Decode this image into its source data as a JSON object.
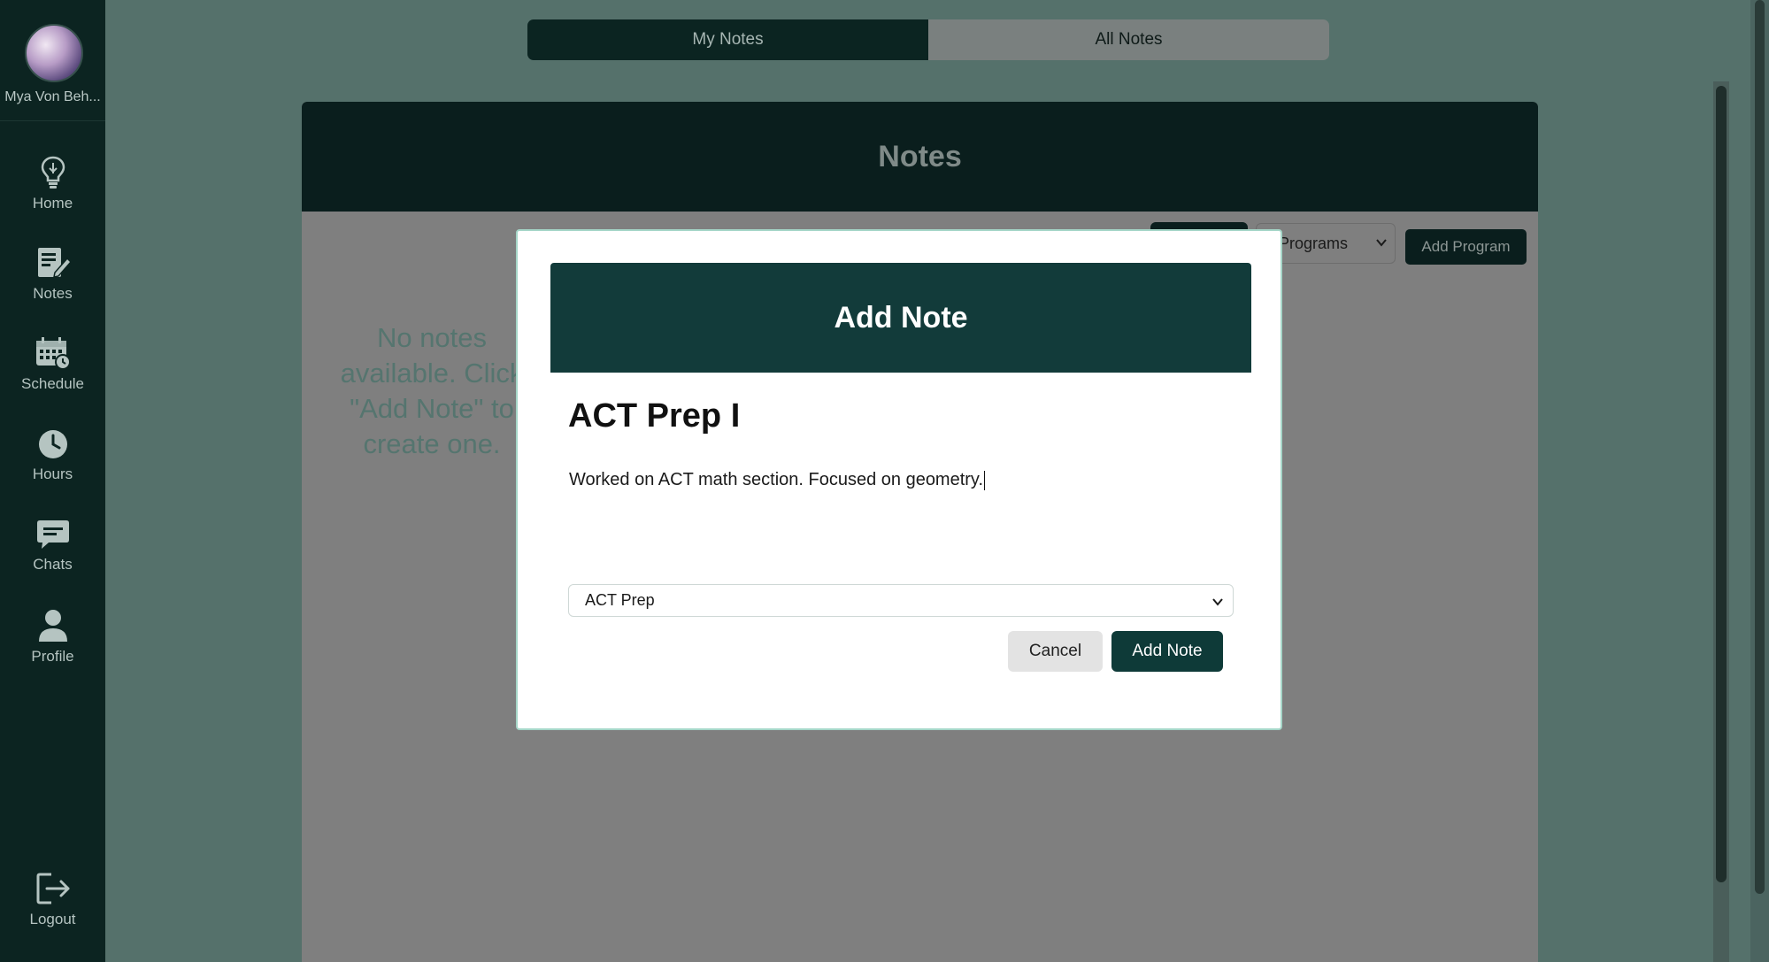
{
  "user": {
    "name": "Mya Von Beh..."
  },
  "nav": {
    "items": [
      {
        "label": "Home",
        "icon": "lightbulb-icon"
      },
      {
        "label": "Notes",
        "icon": "notes-icon"
      },
      {
        "label": "Schedule",
        "icon": "calendar-clock-icon"
      },
      {
        "label": "Hours",
        "icon": "clock-icon"
      },
      {
        "label": "Chats",
        "icon": "chat-bubble-icon"
      },
      {
        "label": "Profile",
        "icon": "person-icon"
      }
    ],
    "logout": {
      "label": "Logout",
      "icon": "logout-icon"
    }
  },
  "tabs": [
    {
      "label": "My Notes",
      "active": true
    },
    {
      "label": "All Notes",
      "active": false
    }
  ],
  "panel": {
    "title": "Notes",
    "program_filter": "ll Programs",
    "add_program_label": "Add Program",
    "empty_message_lines": [
      "No notes",
      "available. Click",
      "\"Add Note\" to",
      "create one."
    ]
  },
  "modal": {
    "title": "Add Note",
    "note_title": "ACT Prep I",
    "note_body": "Worked on ACT math section. Focused on geometry.",
    "program_selected": "ACT Prep",
    "cancel_label": "Cancel",
    "submit_label": "Add Note"
  },
  "colors": {
    "sidebar_bg": "#0c2421",
    "accent": "#123b3a",
    "overlay_bg": "#55716b",
    "modal_border": "#a5d6c8"
  }
}
